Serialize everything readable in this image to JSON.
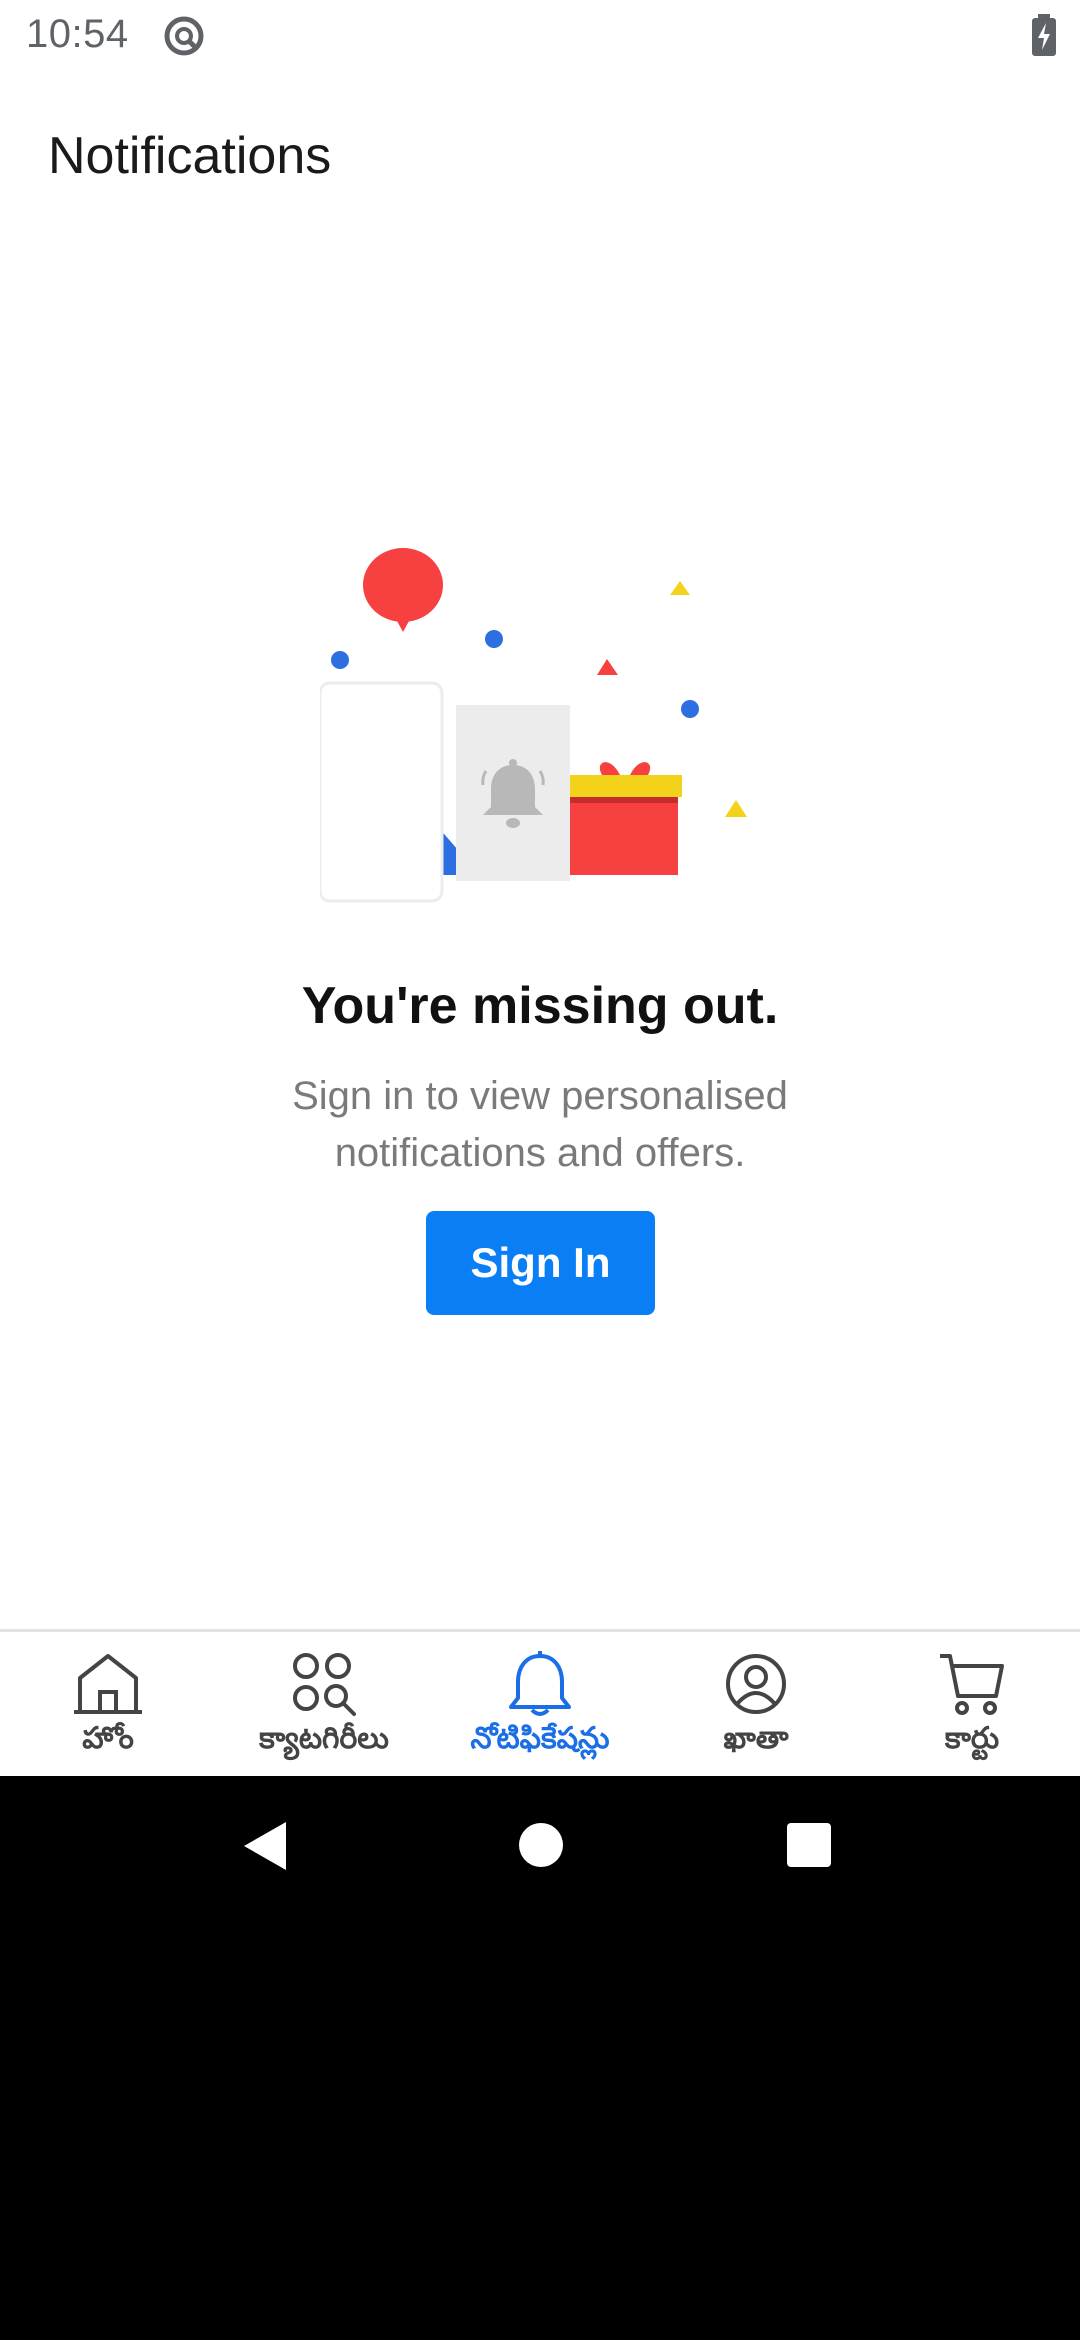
{
  "status_bar": {
    "time": "10:54"
  },
  "header": {
    "title": "Notifications"
  },
  "empty_state": {
    "title": "You're missing out.",
    "description": "Sign in to view personalised notifications and offers.",
    "badge_symbol": "%"
  },
  "actions": {
    "sign_in_label": "Sign In"
  },
  "bottom_nav": {
    "items": [
      {
        "label": "హోం",
        "icon": "home-icon",
        "active": false
      },
      {
        "label": "క్యాటగిరీలు",
        "icon": "categories-icon",
        "active": false
      },
      {
        "label": "నోటిఫికేషన్లు",
        "icon": "bell-icon",
        "active": true
      },
      {
        "label": "ఖాతా",
        "icon": "account-icon",
        "active": false
      },
      {
        "label": "కార్టు",
        "icon": "cart-icon",
        "active": false
      }
    ]
  },
  "colors": {
    "accent": "#0a7ff5",
    "active_nav": "#1a6ee6",
    "inactive_nav": "#444444"
  }
}
